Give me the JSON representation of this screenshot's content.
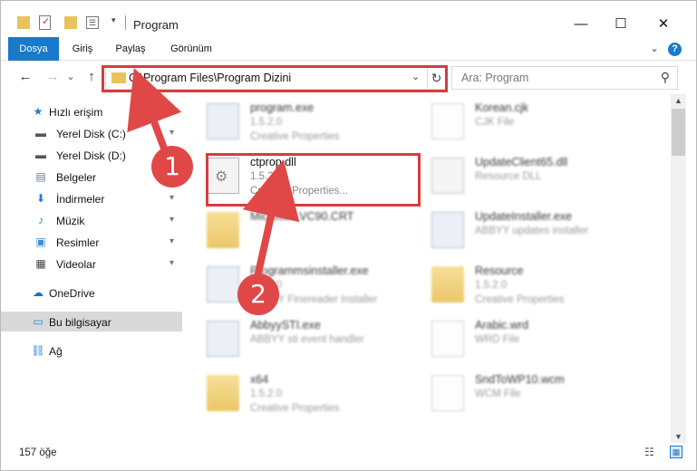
{
  "window": {
    "title": "Program",
    "minimize": "—",
    "maximize": "☐",
    "close": "✕"
  },
  "ribbon": {
    "tabs": [
      "Dosya",
      "Giriş",
      "Paylaş",
      "Görünüm"
    ],
    "help": "?"
  },
  "nav": {
    "back": "←",
    "forward": "→",
    "recent": "⌄",
    "up": "↑",
    "address": "C:\\Program Files\\Program Dizini",
    "dropdown": "⌄",
    "refresh": "↻",
    "search_placeholder": "Ara: Program",
    "search_icon": "⚲"
  },
  "sidebar": {
    "items": [
      {
        "label": "Hızlı erişim",
        "icon": "star-icon",
        "glyph": "★",
        "color": "#1e7bd7"
      },
      {
        "label": "Yerel Disk (C:)",
        "icon": "drive-icon",
        "glyph": "▬",
        "color": "#555555",
        "pinned": true
      },
      {
        "label": "Yerel Disk (D:)",
        "icon": "drive-icon",
        "glyph": "▬",
        "color": "#555555"
      },
      {
        "label": "Belgeler",
        "icon": "documents-icon",
        "glyph": "▤",
        "color": "#6b7b8c",
        "pinned": true
      },
      {
        "label": "İndirmeler",
        "icon": "download-icon",
        "glyph": "⬇",
        "color": "#1e7bd7",
        "pinned": true
      },
      {
        "label": "Müzik",
        "icon": "music-icon",
        "glyph": "♪",
        "color": "#1e7bd7",
        "pinned": true
      },
      {
        "label": "Resimler",
        "icon": "pictures-icon",
        "glyph": "▣",
        "color": "#3a8fd6",
        "pinned": true
      },
      {
        "label": "Videolar",
        "icon": "video-icon",
        "glyph": "▦",
        "color": "#444444",
        "pinned": true
      },
      {
        "label": "OneDrive",
        "icon": "cloud-icon",
        "glyph": "☁",
        "color": "#1e6fc4"
      },
      {
        "label": "Bu bilgisayar",
        "icon": "computer-icon",
        "glyph": "▭",
        "color": "#2a7fd0"
      },
      {
        "label": "Ağ",
        "icon": "network-icon",
        "glyph": "⛓",
        "color": "#2a7fd0"
      }
    ],
    "pin_glyph": "📌"
  },
  "files": [
    {
      "name": "program.exe",
      "line1": "1.5.2.0",
      "line2": "Creative Properties",
      "kind": "app"
    },
    {
      "name": "Korean.cjk",
      "line1": "CJK File",
      "line2": "",
      "kind": "doc"
    },
    {
      "name": "ctprop.dll",
      "line1": "1.5.2.0",
      "line2": "Creative Properties...",
      "kind": "dll"
    },
    {
      "name": "UpdateClient65.dll",
      "line1": "Resource DLL",
      "line2": "",
      "kind": "dll"
    },
    {
      "name": "Microsoft.VC90.CRT",
      "line1": "",
      "line2": "",
      "kind": "folder"
    },
    {
      "name": "UpdateInstaller.exe",
      "line1": "ABBYY updates installer",
      "line2": "",
      "kind": "app"
    },
    {
      "name": "Programmsinstaller.exe",
      "line1": "1.5.2.0",
      "line2": "ABBYY Finereader Installer",
      "kind": "app"
    },
    {
      "name": "Resource",
      "line1": "1.5.2.0",
      "line2": "Creative Properties",
      "kind": "folder"
    },
    {
      "name": "AbbyySTI.exe",
      "line1": "ABBYY sti event handler",
      "line2": "",
      "kind": "app"
    },
    {
      "name": "Arabic.wrd",
      "line1": "WRD File",
      "line2": "",
      "kind": "doc"
    },
    {
      "name": "x64",
      "line1": "1.5.2.0",
      "line2": "Creative Properties",
      "kind": "folder"
    },
    {
      "name": "SndToWP10.wcm",
      "line1": "WCM File",
      "line2": "",
      "kind": "doc"
    }
  ],
  "status": {
    "count": "157 öğe",
    "details_view": "☷",
    "large_icons_view": "▦"
  },
  "callouts": [
    "1",
    "2"
  ],
  "colors": {
    "accent": "#1979ca",
    "highlight": "#d83c3c",
    "callout": "#e04848"
  }
}
